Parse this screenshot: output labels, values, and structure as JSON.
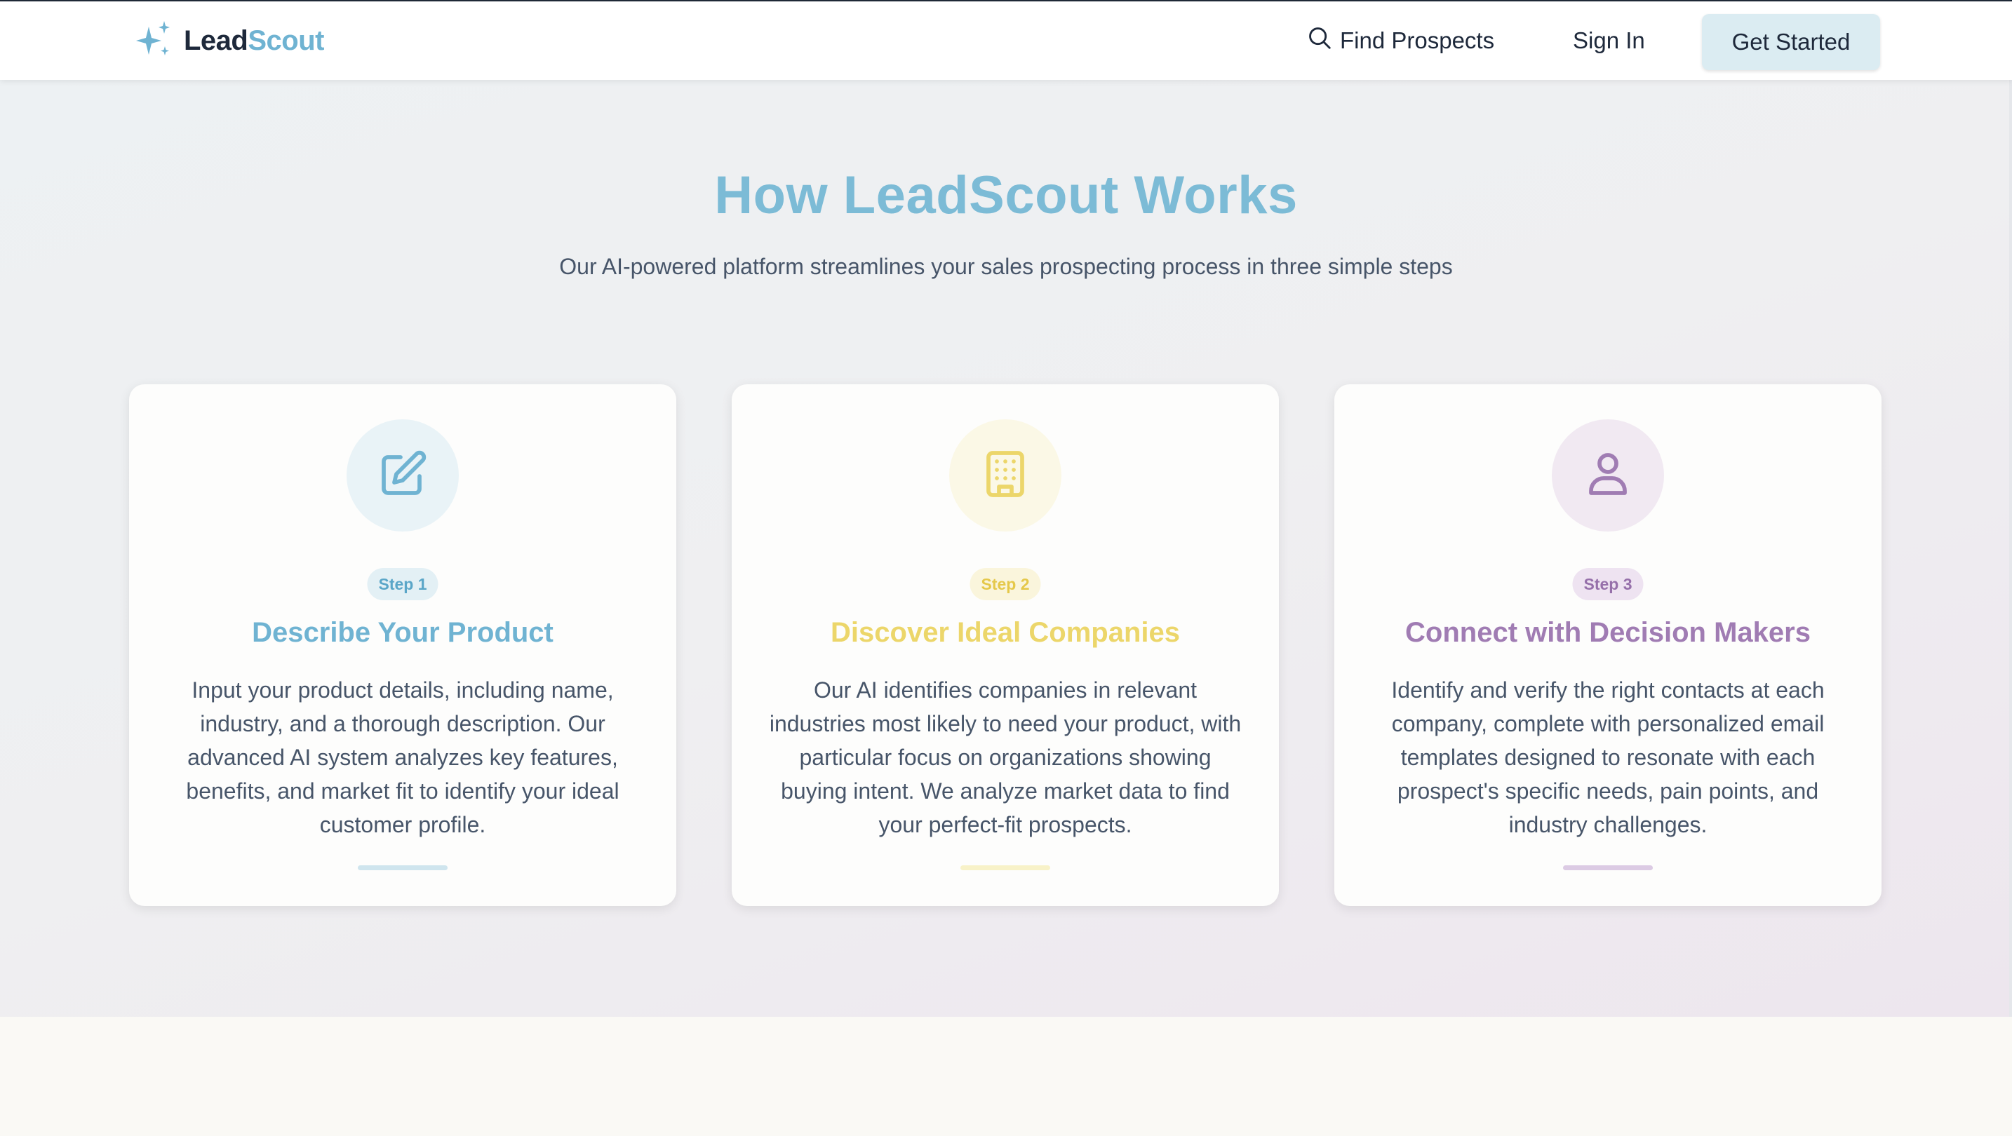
{
  "app": {
    "name_part1": "Lead",
    "name_part2": "Scout"
  },
  "nav": {
    "find_label": "Find Prospects",
    "signin_label": "Sign In",
    "cta_label": "Get Started",
    "find_icon": "search-icon",
    "logo_icon": "sparkles-icon"
  },
  "section": {
    "title": "How LeadScout Works",
    "subtitle": "Our AI-powered platform streamlines your sales prospecting process in three simple steps"
  },
  "steps": [
    {
      "badge": "Step 1",
      "title": "Describe Your Product",
      "description": "Input your product details, including name, industry, and a thorough description. Our advanced AI system analyzes key features, benefits, and market fit to identify your ideal customer profile.",
      "icon": "edit-icon",
      "color": "#6fb3d2",
      "tint": "#e9f3f7"
    },
    {
      "badge": "Step 2",
      "title": "Discover Ideal Companies",
      "description": "Our AI identifies companies in relevant industries most likely to need your product, with particular focus on organizations showing buying intent. We analyze market data to find your perfect-fit prospects.",
      "icon": "building-icon",
      "color": "#ecd66a",
      "tint": "#fbf8e6"
    },
    {
      "badge": "Step 3",
      "title": "Connect with Decision Makers",
      "description": "Identify and verify the right contacts at each company, complete with personalized email templates designed to resonate with each prospect's specific needs, pain points, and industry challenges.",
      "icon": "user-icon",
      "color": "#a07cb3",
      "tint": "#f1e9f2"
    }
  ]
}
